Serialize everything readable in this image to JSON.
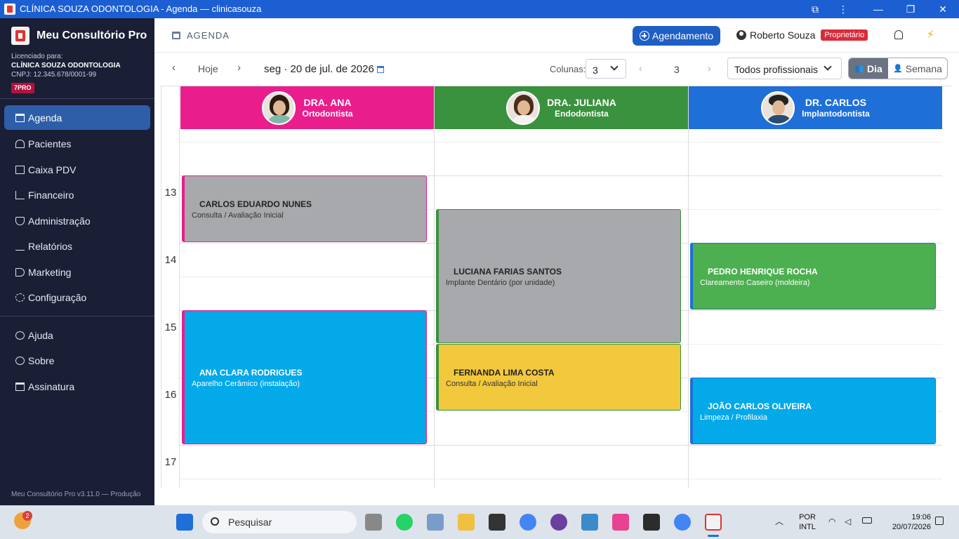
{
  "window": {
    "title": "CLÍNICA SOUZA ODONTOLOGIA - Agenda — clinicasouza"
  },
  "sidebar": {
    "brand": "Meu Consultório Pro",
    "license_label": "Licenciado para:",
    "clinic": "CLÍNICA SOUZA ODONTOLOGIA",
    "cnpj": "CNPJ: 12.345.678/0001-99",
    "plan": "7PRO",
    "items": [
      {
        "label": "Agenda",
        "icon": "calendar-icon",
        "active": true
      },
      {
        "label": "Pacientes",
        "icon": "users-icon"
      },
      {
        "label": "Caixa PDV",
        "icon": "cash-register-icon"
      },
      {
        "label": "Financeiro",
        "icon": "chart-line-icon"
      },
      {
        "label": "Administração",
        "icon": "shield-icon"
      },
      {
        "label": "Relatórios",
        "icon": "bar-chart-icon"
      },
      {
        "label": "Marketing",
        "icon": "megaphone-icon"
      },
      {
        "label": "Configuração",
        "icon": "gear-icon"
      }
    ],
    "secondary": [
      {
        "label": "Ajuda",
        "icon": "help-icon"
      },
      {
        "label": "Sobre",
        "icon": "info-icon"
      },
      {
        "label": "Assinatura",
        "icon": "card-icon"
      }
    ],
    "version": "Meu Consultório Pro v3.11.0 — Produção"
  },
  "topbar": {
    "page_title": "AGENDA",
    "new_button": "Agendamento",
    "user": "Roberto Souza",
    "role": "Proprietário"
  },
  "toolbar": {
    "today": "Hoje",
    "date": "seg · 20 de jul. de 2026",
    "columns_label": "Colunas:",
    "columns_value": "3",
    "page": "3",
    "professional_filter": "Todos profissionais",
    "view_day": "Dia",
    "view_week": "Semana"
  },
  "calendar": {
    "hours": [
      "13",
      "14",
      "15",
      "16",
      "17"
    ],
    "professionals": [
      {
        "name": "DRA. ANA",
        "specialty": "Ortodontista",
        "color": "#e91e8c"
      },
      {
        "name": "DRA. JULIANA",
        "specialty": "Endodontista",
        "color": "#3a923e"
      },
      {
        "name": "DR. CARLOS",
        "specialty": "Implantodontista",
        "color": "#1e6fd8"
      }
    ],
    "appointments": [
      {
        "patient": "CARLOS EDUARDO NUNES",
        "service": "Consulta / Avaliação Inicial",
        "professional": "DRA. ANA",
        "start": "13:00",
        "end": "14:00",
        "color": "#a8a9ad"
      },
      {
        "patient": "ANA CLARA RODRIGUES",
        "service": "Aparelho Cerâmico (instalação)",
        "professional": "DRA. ANA",
        "start": "15:00",
        "end": "17:00",
        "color": "#03a9e8"
      },
      {
        "patient": "LUCIANA FARIAS SANTOS",
        "service": "Implante Dentário (por unidade)",
        "professional": "DRA. JULIANA",
        "start": "13:30",
        "end": "15:30",
        "color": "#a8a9ad"
      },
      {
        "patient": "FERNANDA LIMA COSTA",
        "service": "Consulta / Avaliação Inicial",
        "professional": "DRA. JULIANA",
        "start": "15:30",
        "end": "16:30",
        "color": "#f2c83c"
      },
      {
        "patient": "PEDRO HENRIQUE ROCHA",
        "service": "Clareamento Caseiro (moldeira)",
        "professional": "DR. CARLOS",
        "start": "14:00",
        "end": "15:00",
        "color": "#4caf50"
      },
      {
        "patient": "JOÃO CARLOS OLIVEIRA",
        "service": "Limpeza / Profilaxia",
        "professional": "DR. CARLOS",
        "start": "16:00",
        "end": "17:00",
        "color": "#03a9e8"
      }
    ]
  },
  "taskbar": {
    "search": "Pesquisar",
    "notification_count": "2",
    "lang": "POR",
    "lang2": "INTL",
    "time": "19:06",
    "date": "20/07/2026"
  }
}
